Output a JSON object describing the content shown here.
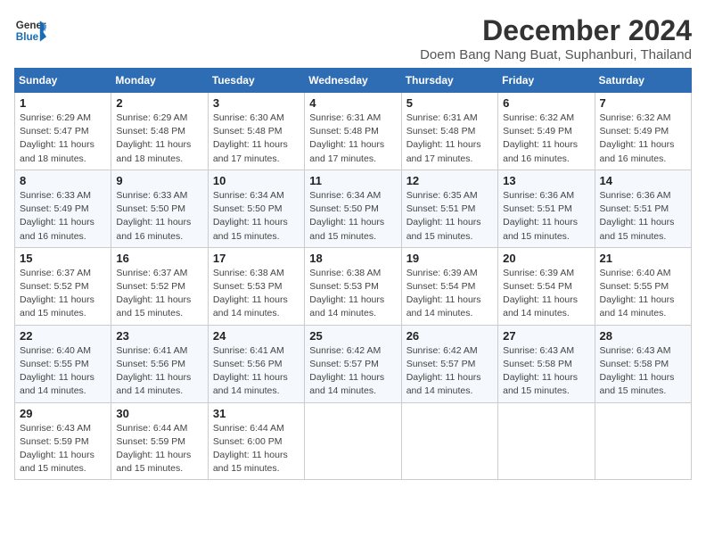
{
  "header": {
    "logo_line1": "General",
    "logo_line2": "Blue",
    "month": "December 2024",
    "location": "Doem Bang Nang Buat, Suphanburi, Thailand"
  },
  "weekdays": [
    "Sunday",
    "Monday",
    "Tuesday",
    "Wednesday",
    "Thursday",
    "Friday",
    "Saturday"
  ],
  "weeks": [
    [
      {
        "day": "1",
        "info": "Sunrise: 6:29 AM\nSunset: 5:47 PM\nDaylight: 11 hours\nand 18 minutes."
      },
      {
        "day": "2",
        "info": "Sunrise: 6:29 AM\nSunset: 5:48 PM\nDaylight: 11 hours\nand 18 minutes."
      },
      {
        "day": "3",
        "info": "Sunrise: 6:30 AM\nSunset: 5:48 PM\nDaylight: 11 hours\nand 17 minutes."
      },
      {
        "day": "4",
        "info": "Sunrise: 6:31 AM\nSunset: 5:48 PM\nDaylight: 11 hours\nand 17 minutes."
      },
      {
        "day": "5",
        "info": "Sunrise: 6:31 AM\nSunset: 5:48 PM\nDaylight: 11 hours\nand 17 minutes."
      },
      {
        "day": "6",
        "info": "Sunrise: 6:32 AM\nSunset: 5:49 PM\nDaylight: 11 hours\nand 16 minutes."
      },
      {
        "day": "7",
        "info": "Sunrise: 6:32 AM\nSunset: 5:49 PM\nDaylight: 11 hours\nand 16 minutes."
      }
    ],
    [
      {
        "day": "8",
        "info": "Sunrise: 6:33 AM\nSunset: 5:49 PM\nDaylight: 11 hours\nand 16 minutes."
      },
      {
        "day": "9",
        "info": "Sunrise: 6:33 AM\nSunset: 5:50 PM\nDaylight: 11 hours\nand 16 minutes."
      },
      {
        "day": "10",
        "info": "Sunrise: 6:34 AM\nSunset: 5:50 PM\nDaylight: 11 hours\nand 15 minutes."
      },
      {
        "day": "11",
        "info": "Sunrise: 6:34 AM\nSunset: 5:50 PM\nDaylight: 11 hours\nand 15 minutes."
      },
      {
        "day": "12",
        "info": "Sunrise: 6:35 AM\nSunset: 5:51 PM\nDaylight: 11 hours\nand 15 minutes."
      },
      {
        "day": "13",
        "info": "Sunrise: 6:36 AM\nSunset: 5:51 PM\nDaylight: 11 hours\nand 15 minutes."
      },
      {
        "day": "14",
        "info": "Sunrise: 6:36 AM\nSunset: 5:51 PM\nDaylight: 11 hours\nand 15 minutes."
      }
    ],
    [
      {
        "day": "15",
        "info": "Sunrise: 6:37 AM\nSunset: 5:52 PM\nDaylight: 11 hours\nand 15 minutes."
      },
      {
        "day": "16",
        "info": "Sunrise: 6:37 AM\nSunset: 5:52 PM\nDaylight: 11 hours\nand 15 minutes."
      },
      {
        "day": "17",
        "info": "Sunrise: 6:38 AM\nSunset: 5:53 PM\nDaylight: 11 hours\nand 14 minutes."
      },
      {
        "day": "18",
        "info": "Sunrise: 6:38 AM\nSunset: 5:53 PM\nDaylight: 11 hours\nand 14 minutes."
      },
      {
        "day": "19",
        "info": "Sunrise: 6:39 AM\nSunset: 5:54 PM\nDaylight: 11 hours\nand 14 minutes."
      },
      {
        "day": "20",
        "info": "Sunrise: 6:39 AM\nSunset: 5:54 PM\nDaylight: 11 hours\nand 14 minutes."
      },
      {
        "day": "21",
        "info": "Sunrise: 6:40 AM\nSunset: 5:55 PM\nDaylight: 11 hours\nand 14 minutes."
      }
    ],
    [
      {
        "day": "22",
        "info": "Sunrise: 6:40 AM\nSunset: 5:55 PM\nDaylight: 11 hours\nand 14 minutes."
      },
      {
        "day": "23",
        "info": "Sunrise: 6:41 AM\nSunset: 5:56 PM\nDaylight: 11 hours\nand 14 minutes."
      },
      {
        "day": "24",
        "info": "Sunrise: 6:41 AM\nSunset: 5:56 PM\nDaylight: 11 hours\nand 14 minutes."
      },
      {
        "day": "25",
        "info": "Sunrise: 6:42 AM\nSunset: 5:57 PM\nDaylight: 11 hours\nand 14 minutes."
      },
      {
        "day": "26",
        "info": "Sunrise: 6:42 AM\nSunset: 5:57 PM\nDaylight: 11 hours\nand 14 minutes."
      },
      {
        "day": "27",
        "info": "Sunrise: 6:43 AM\nSunset: 5:58 PM\nDaylight: 11 hours\nand 15 minutes."
      },
      {
        "day": "28",
        "info": "Sunrise: 6:43 AM\nSunset: 5:58 PM\nDaylight: 11 hours\nand 15 minutes."
      }
    ],
    [
      {
        "day": "29",
        "info": "Sunrise: 6:43 AM\nSunset: 5:59 PM\nDaylight: 11 hours\nand 15 minutes."
      },
      {
        "day": "30",
        "info": "Sunrise: 6:44 AM\nSunset: 5:59 PM\nDaylight: 11 hours\nand 15 minutes."
      },
      {
        "day": "31",
        "info": "Sunrise: 6:44 AM\nSunset: 6:00 PM\nDaylight: 11 hours\nand 15 minutes."
      },
      null,
      null,
      null,
      null
    ]
  ]
}
